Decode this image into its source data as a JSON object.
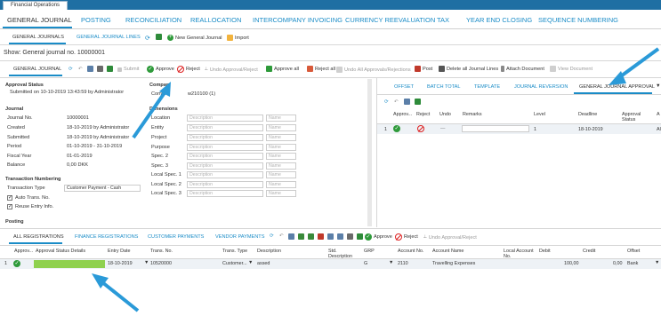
{
  "window_tab": "Financial Operations",
  "main_nav": [
    "GENERAL JOURNAL",
    "POSTING",
    "RECONCILIATION",
    "REALLOCATION",
    "INTERCOMPANY INVOICING",
    "CURRENCY REEVALUATION",
    "TAX",
    "YEAR END CLOSING",
    "SEQUENCE NUMBERING"
  ],
  "sub_tabs": {
    "journals": "GENERAL JOURNALS",
    "lines": "GENERAL JOURNAL LINES",
    "new": "New General Journal",
    "import": "Import"
  },
  "show_line": "Show:  General journal no. 10000001",
  "toolbar": {
    "tab": "GENERAL JOURNAL",
    "submit": "Submit",
    "approve": "Approve",
    "reject": "Reject",
    "undo": "Undo Approval/Reject",
    "approve_all": "Approve all",
    "reject_all": "Reject all",
    "undo_all": "Undo All Approvals/Rejections",
    "post": "Post",
    "delete_all": "Delete all Journal Lines",
    "attach": "Attach Document",
    "view": "View Document"
  },
  "approval": {
    "heading": "Approval Status",
    "text": "Submitted on 10-10-2019 13:43:59 by Administrator"
  },
  "journal": {
    "heading": "Journal",
    "rows": [
      [
        "Journal No.",
        "10000001"
      ],
      [
        "Created",
        "18-10-2019 by Administrator"
      ],
      [
        "Submitted",
        "18-10-2019 by Administrator"
      ],
      [
        "Period",
        "01-10-2019 - 31-10-2019"
      ],
      [
        "Fiscal Year",
        "01-01-2019"
      ],
      [
        "Balance",
        "0,00 DKK"
      ]
    ]
  },
  "tn": {
    "heading": "Transaction Numbering",
    "type_label": "Transaction Type",
    "type_value": "Customer Payment - Cash",
    "auto": "Auto Trans. No.",
    "reuse": "Reuse Entry Info."
  },
  "posting_heading": "Posting",
  "company": {
    "heading": "Compan",
    "label": "Comm",
    "value": "w210100 (1)"
  },
  "dimensions": {
    "heading": "Dimensions",
    "placeholder": "Description",
    "name_placeholder": "Name",
    "items": [
      "Location",
      "Entity",
      "Project",
      "Purpose",
      "Spec. 2",
      "Spec. 3",
      "Local Spec. 1",
      "Local Spec. 2",
      "Local Spec. 3"
    ]
  },
  "right_tabs": [
    "OFFSET",
    "BATCH TOTAL",
    "TEMPLATE",
    "JOURNAL REVERSION",
    "GENERAL JOURNAL APPROVAL"
  ],
  "approval_grid": {
    "headers": [
      "Approv...",
      "Reject",
      "Undo",
      "Remarks",
      "Level",
      "Deadline",
      "Approval Status",
      "A"
    ],
    "row": {
      "num": "1",
      "undo": "—",
      "level": "1",
      "deadline": "18-10-2019",
      "status": "Al"
    }
  },
  "bottom_tabs": [
    "ALL REGISTRATIONS",
    "FINANCE REGISTRATIONS",
    "CUSTOMER PAYMENTS",
    "VENDOR PAYMENTS"
  ],
  "bottom_toolbar": {
    "approve": "Approve",
    "reject": "Reject",
    "undo": "Undo Approval/Reject"
  },
  "grid": {
    "headers": [
      "Approv...",
      "Approval Status Details",
      "Entry Date",
      "Trans. No.",
      "Trans. Type",
      "Description",
      "Std. Description",
      "GRP",
      "Account No.",
      "Account Name",
      "Local Account No.",
      "Debit",
      "Credit",
      "Offset"
    ],
    "row": {
      "num": "1",
      "date": "18-10-2019",
      "trans": "10520000",
      "type": "Customer...",
      "desc": "assed",
      "grp": "G",
      "acct": "2110",
      "name": "Travelling Expenses",
      "debit": "100,00",
      "credit": "0,00",
      "offset": "Bank"
    }
  },
  "colors": {
    "accent": "#1a8cc7",
    "green": "#2e9a3a",
    "bar": "#8fd14f",
    "arrow": "#2a9ad8"
  }
}
